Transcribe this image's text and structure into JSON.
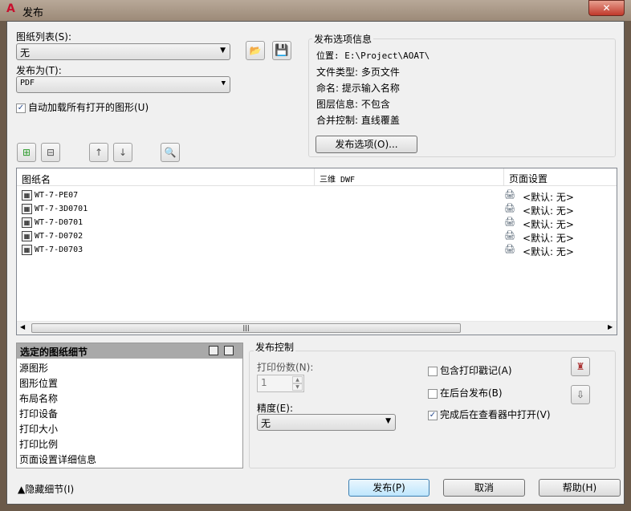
{
  "window": {
    "title": "发布",
    "close": "✕"
  },
  "sheet_list": {
    "label": "图纸列表(S):",
    "value": "无"
  },
  "publish_to": {
    "label": "发布为(T):",
    "value": "PDF"
  },
  "auto_load": {
    "label": "自动加载所有打开的图形(U)",
    "checked": true
  },
  "options_info": {
    "title": "发布选项信息",
    "lines": [
      "位置: E:\\Project\\AOAT\\",
      "文件类型: 多页文件",
      "命名: 提示输入名称",
      "图层信息: 不包含",
      "合并控制: 直线覆盖"
    ],
    "button": "发布选项(O)..."
  },
  "table": {
    "headers": [
      "图纸名",
      "三维 DWF",
      "页面设置"
    ],
    "rows": [
      {
        "name": "WT-7-PE07",
        "dwf": "",
        "setup": "<默认: 无>"
      },
      {
        "name": "WT-7-3D0701",
        "dwf": "",
        "setup": "<默认: 无>"
      },
      {
        "name": "WT-7-D0701",
        "dwf": "",
        "setup": "<默认: 无>"
      },
      {
        "name": "WT-7-D0702",
        "dwf": "",
        "setup": "<默认: 无>"
      },
      {
        "name": "WT-7-D0703",
        "dwf": "",
        "setup": "<默认: 无>"
      }
    ]
  },
  "details": {
    "title": "选定的图纸细节",
    "items": [
      "源图形",
      "图形位置",
      "布局名称",
      "打印设备",
      "打印大小",
      "打印比例",
      "页面设置详细信息"
    ]
  },
  "control": {
    "title": "发布控制",
    "copies_label": "打印份数(N):",
    "copies": "1",
    "precision_label": "精度(E):",
    "precision": "无",
    "stamp": {
      "label": "包含打印戳记(A)",
      "checked": false
    },
    "background": {
      "label": "在后台发布(B)",
      "checked": false
    },
    "open_viewer": {
      "label": "完成后在查看器中打开(V)",
      "checked": true
    }
  },
  "footer": {
    "hide_details": "▲隐藏细节(I)",
    "publish": "发布(P)",
    "cancel": "取消",
    "help": "帮助(H)"
  }
}
